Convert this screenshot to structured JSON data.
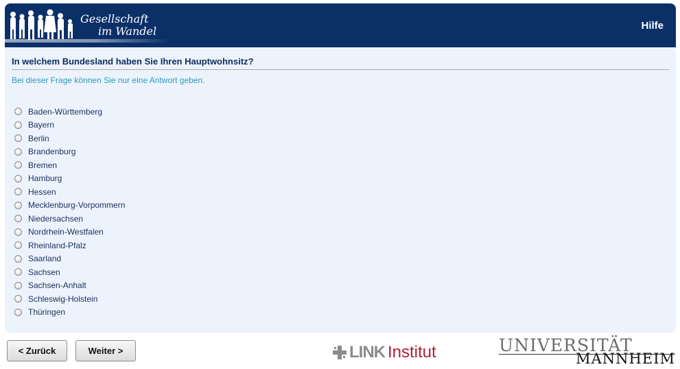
{
  "header": {
    "logo_line1": "Gesellschaft",
    "logo_line2": "im Wandel",
    "help_label": "Hilfe"
  },
  "question": {
    "title": "In welchem Bundesland haben Sie Ihren Hauptwohnsitz?",
    "instruction": "Bei dieser Frage können Sie nur eine Antwort geben."
  },
  "options": [
    "Baden-Württemberg",
    "Bayern",
    "Berlin",
    "Brandenburg",
    "Bremen",
    "Hamburg",
    "Hessen",
    "Mecklenburg-Vorpommern",
    "Niedersachsen",
    "Nordrhein-Westfalen",
    "Rheinland-Pfalz",
    "Saarland",
    "Sachsen",
    "Sachsen-Anhalt",
    "Schleswig-Holstein",
    "Thüringen"
  ],
  "navigation": {
    "back_label": "< Zurück",
    "next_label": "Weiter >"
  },
  "logos": {
    "link_text": "LINK",
    "link_institut": "Institut",
    "uni_top": "UNIVERSITÄT",
    "uni_bottom": "MANNHEIM"
  },
  "colors": {
    "header_bg": "#0b3068",
    "panel_bg": "#edf3fd",
    "question_color": "#0b2e5c",
    "instruction_color": "#2a9bbd",
    "link_red": "#b01e33"
  }
}
